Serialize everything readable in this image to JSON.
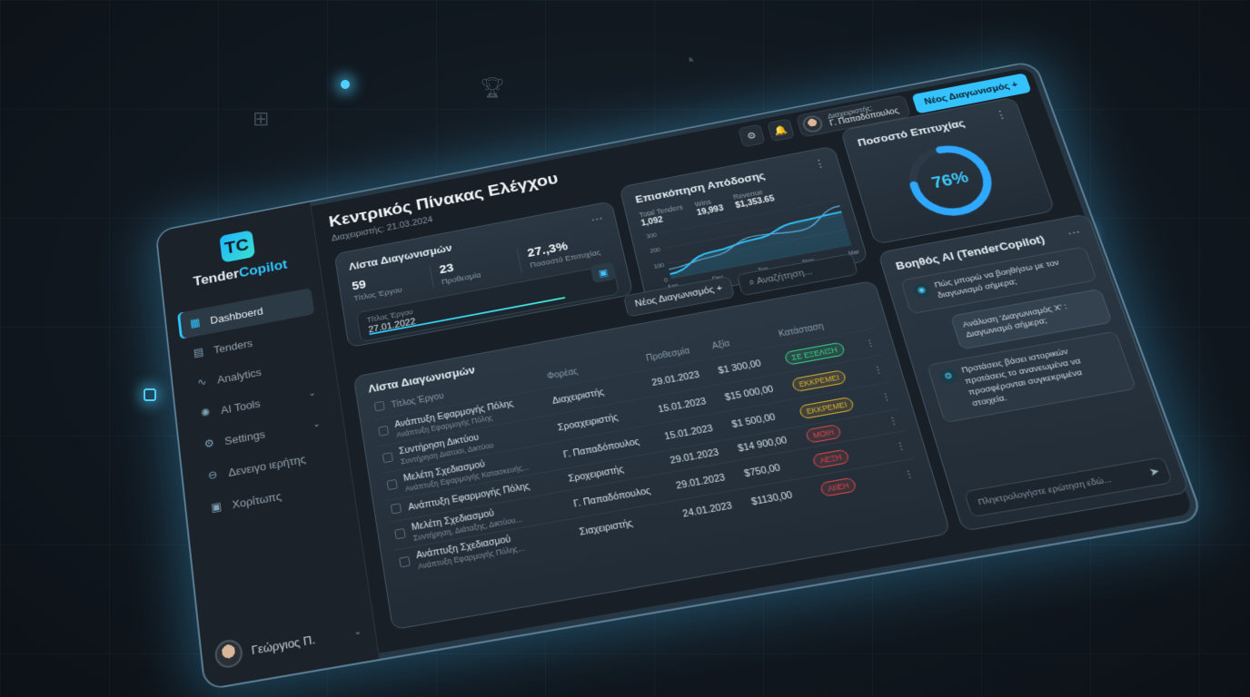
{
  "app": {
    "name_main": "Tender",
    "name_accent": "Copilot",
    "logo_glyph": "TC"
  },
  "sidebar": {
    "items": [
      {
        "label": "Dashboerd",
        "icon": "grid-icon",
        "glyph": "▦",
        "active": true
      },
      {
        "label": "Tenders",
        "icon": "document-icon",
        "glyph": "▤",
        "active": false
      },
      {
        "label": "Analytics",
        "icon": "chart-icon",
        "glyph": "∿",
        "active": false
      },
      {
        "label": "AI Tools",
        "icon": "ai-icon",
        "glyph": "✺",
        "active": false,
        "chevron": "⌄"
      },
      {
        "label": "Settings",
        "icon": "gear-icon",
        "glyph": "⚙",
        "active": false,
        "chevron": "⌄"
      },
      {
        "label": "Δενειγο ιερήτης",
        "icon": "minus-circle-icon",
        "glyph": "⊖",
        "active": false
      },
      {
        "label": "Χορίτωπς",
        "icon": "image-icon",
        "glyph": "▣",
        "active": false
      }
    ],
    "user_name": "Γεώργιος Π.",
    "user_chevron": "⌄"
  },
  "topbar": {
    "settings_glyph": "⚙",
    "bell_glyph": "🔔",
    "user_role": "Διαχειριστής:",
    "user_name": "Γ. Παπαδόπουλος",
    "cta_label": "Νέος Διαγωνισμός",
    "cta_glyph": "+"
  },
  "page": {
    "title": "Κεντρικός Πίνακας Ελέγχου",
    "subtitle": "Διαχειριστής: 21.03.2024"
  },
  "summary": {
    "title": "Λίστα Διαγωνισμών",
    "kebab": "⋯",
    "stats": [
      {
        "value": "59",
        "label": "Τίτλος Έργου"
      },
      {
        "value": "23",
        "label": "Προθεσμία"
      },
      {
        "value": "27.,3%",
        "label": "Ποσοστό Επιτυχίας"
      }
    ],
    "field_placeholder": "Τίτλος Έργου",
    "field_value": "27.01.2022",
    "cal_glyph": "▣"
  },
  "performance": {
    "title": "Επισκόπηση Απόδοσης",
    "kebab": "⋮",
    "kpis": [
      {
        "label": "Total Tenders",
        "value": "1,092"
      },
      {
        "label": "Wins",
        "value": "19,993"
      },
      {
        "label": "Revenue",
        "value": "$1,353.65"
      }
    ]
  },
  "chart_data": {
    "type": "line",
    "categories": [
      "Ann",
      "Dec",
      "Ton",
      "Nov",
      "Mar"
    ],
    "yticks": [
      0,
      100,
      200,
      300
    ],
    "ylim": [
      0,
      300
    ],
    "series": [
      {
        "values": [
          30,
          120,
          150,
          210,
          220
        ],
        "color": "#2fc6ff"
      },
      {
        "values": [
          60,
          90,
          170,
          150,
          260
        ],
        "color": "#5aa8d8"
      }
    ]
  },
  "success": {
    "title": "Ποσοστό Επιτυχίας",
    "kebab": "⋮",
    "value": "76%",
    "fraction": 0.76
  },
  "table_tools": {
    "new_label": "Νέος Διαγωνισμός",
    "new_glyph": "+",
    "search_placeholder": "Αναζήτηση..."
  },
  "table": {
    "title": "Λίστα Διαγωνισμών",
    "columns": [
      "Τίτλος Έργου",
      "Φορέας",
      "Προθεσμία",
      "Αξία",
      "Κατάσταση"
    ],
    "rows": [
      {
        "title": "Ανάπτυξη Εφαρμογής Πόλης",
        "sub": "Ανάπτυξη Εφαρμογής Πόλης",
        "org": "Διαχειριστής",
        "date": "29.01.2023",
        "value": "$1 300,00",
        "status": "ΣΕ ΕΞΕΛΙΞΗ",
        "status_color": "#39d98a"
      },
      {
        "title": "Συντήρηση Δικτύου",
        "sub": "Συντήρηση Διατοσι, Δικτύου",
        "org": "Σροαχειριστής",
        "date": "15.01.2023",
        "value": "$15 000,00",
        "status": "ΕΚΚΡΕΜΕΙ",
        "status_color": "#e0b030"
      },
      {
        "title": "Μελέτη Σχεδιασμού",
        "sub": "Ανάπτυξη Εφαρμογής Κατασκευής...",
        "org": "Γ. Παπαδόπουλος",
        "date": "15.01.2023",
        "value": "$1 500,00",
        "status": "ΕΚΚΡΕΜΕΙ",
        "status_color": "#e0b030"
      },
      {
        "title": "Ανάπτυξη Εφαρμογής Πόλης",
        "sub": "",
        "org": "Σροχειριστής",
        "date": "29.01.2023",
        "value": "$14 900,00",
        "status": "ΜΟΙΗ",
        "status_color": "#e04848"
      },
      {
        "title": "Μελέτη Σχεδιασμού",
        "sub": "Συντήρηση, Διάταξης, Δικτύου...",
        "org": "Γ. Παπαδόπουλος",
        "date": "29.01.2023",
        "value": "$750,00",
        "status": "ΑΕΞΗ",
        "status_color": "#e04848"
      },
      {
        "title": "Ανάπτυξη Σχεδιασμού",
        "sub": "Ανάπτυξη Εφαρμογής Πόλης...",
        "org": "Σιαχειριστής",
        "date": "24.01.2023",
        "value": "$1130,00",
        "status": "ΑΙΙΕΗ",
        "status_color": "#e04848"
      }
    ]
  },
  "ai": {
    "title": "Βοηθός AI (TenderCopilot)",
    "kebab": "⋯",
    "messages": [
      {
        "from": "bot",
        "text": "Πώς μπορώ να βοηθήσω με τον διαγωνισμό σήμερα;"
      },
      {
        "from": "user",
        "text": "Ανάλυση 'Διαγωνισμός Χ' : Διαγωνισμό σήμερα;"
      },
      {
        "from": "bot",
        "text": "Προτάσεις βάσει ιστορικών προτάσεις το ανανεωμένα να προσφέρονται συγκεκριμένα στοιχεία."
      }
    ],
    "input_placeholder": "Πληκτρολογήστε ερώτηση εδώ...",
    "send_glyph": "➤"
  }
}
